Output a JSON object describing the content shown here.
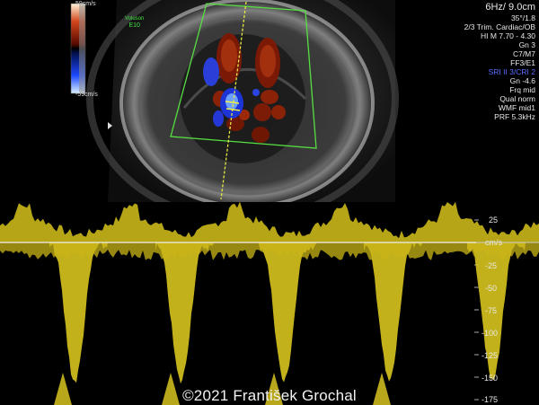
{
  "scale": {
    "top_label": "59cm/s",
    "bottom_label": "-59cm/s"
  },
  "volume": {
    "line1": "Voluson",
    "line2": "E10"
  },
  "params": {
    "frame": "6Hz/ 9.0cm",
    "lines": [
      "35°/1.8",
      "2/3 Trim. Cardiac/OB",
      "HI M  7.70 - 4.30",
      "Gn  3",
      "C7/M7",
      "FF3/E1"
    ],
    "sri": "SRI II 3/CRI 2",
    "doppler": [
      "Gn -4.6",
      "Frq mid",
      "Qual norm",
      "WMF mid1",
      "PRF  5.3kHz"
    ]
  },
  "spectral_axis": {
    "unit": "cm/s",
    "ticks": [
      "25",
      "-25",
      "-50",
      "-75",
      "-100",
      "-125",
      "-150",
      "-175"
    ]
  },
  "copyright": "©2021 František Grochal"
}
